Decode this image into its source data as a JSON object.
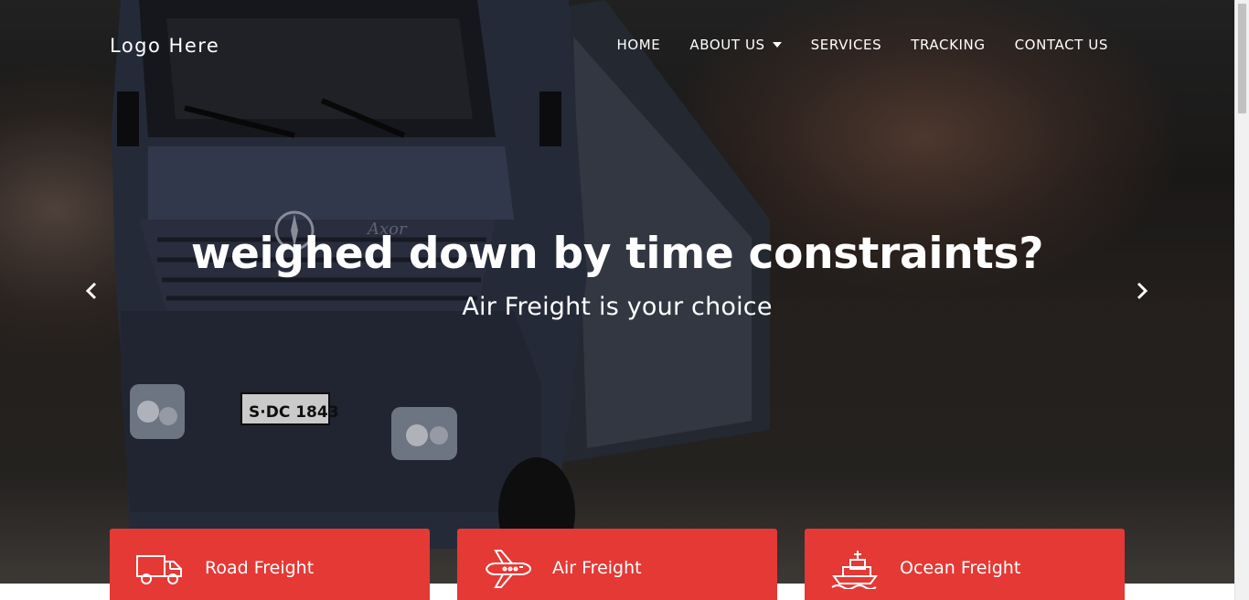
{
  "header": {
    "logo_text": "Logo Here",
    "nav": [
      {
        "label": "HOME"
      },
      {
        "label": "ABOUT US"
      },
      {
        "label": "SERVICES"
      },
      {
        "label": "TRACKING"
      },
      {
        "label": "CONTACT US"
      }
    ]
  },
  "hero": {
    "headline": "weighed down by time constraints?",
    "subheadline": "Air Freight is your choice",
    "prev_icon": "chevron-left-icon",
    "next_icon": "chevron-right-icon",
    "truck_plate": "S·DC 1843",
    "truck_badge": "Axor"
  },
  "services": [
    {
      "label": "Road Freight",
      "icon": "truck-icon"
    },
    {
      "label": "Air Freight",
      "icon": "airplane-icon"
    },
    {
      "label": "Ocean Freight",
      "icon": "ship-icon"
    }
  ],
  "colors": {
    "accent": "#e53935",
    "text_light": "#ffffff"
  }
}
